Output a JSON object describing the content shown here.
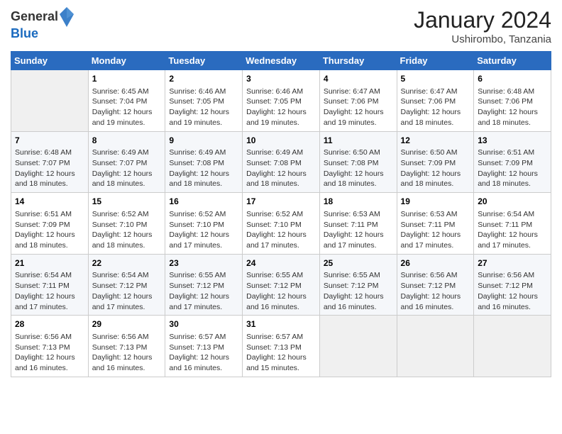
{
  "header": {
    "logo_line1": "General",
    "logo_line2": "Blue",
    "title": "January 2024",
    "subtitle": "Ushirombo, Tanzania"
  },
  "days_of_week": [
    "Sunday",
    "Monday",
    "Tuesday",
    "Wednesday",
    "Thursday",
    "Friday",
    "Saturday"
  ],
  "weeks": [
    [
      {
        "day": "",
        "detail": ""
      },
      {
        "day": "1",
        "detail": "Sunrise: 6:45 AM\nSunset: 7:04 PM\nDaylight: 12 hours\nand 19 minutes."
      },
      {
        "day": "2",
        "detail": "Sunrise: 6:46 AM\nSunset: 7:05 PM\nDaylight: 12 hours\nand 19 minutes."
      },
      {
        "day": "3",
        "detail": "Sunrise: 6:46 AM\nSunset: 7:05 PM\nDaylight: 12 hours\nand 19 minutes."
      },
      {
        "day": "4",
        "detail": "Sunrise: 6:47 AM\nSunset: 7:06 PM\nDaylight: 12 hours\nand 19 minutes."
      },
      {
        "day": "5",
        "detail": "Sunrise: 6:47 AM\nSunset: 7:06 PM\nDaylight: 12 hours\nand 18 minutes."
      },
      {
        "day": "6",
        "detail": "Sunrise: 6:48 AM\nSunset: 7:06 PM\nDaylight: 12 hours\nand 18 minutes."
      }
    ],
    [
      {
        "day": "7",
        "detail": "Sunrise: 6:48 AM\nSunset: 7:07 PM\nDaylight: 12 hours\nand 18 minutes."
      },
      {
        "day": "8",
        "detail": "Sunrise: 6:49 AM\nSunset: 7:07 PM\nDaylight: 12 hours\nand 18 minutes."
      },
      {
        "day": "9",
        "detail": "Sunrise: 6:49 AM\nSunset: 7:08 PM\nDaylight: 12 hours\nand 18 minutes."
      },
      {
        "day": "10",
        "detail": "Sunrise: 6:49 AM\nSunset: 7:08 PM\nDaylight: 12 hours\nand 18 minutes."
      },
      {
        "day": "11",
        "detail": "Sunrise: 6:50 AM\nSunset: 7:08 PM\nDaylight: 12 hours\nand 18 minutes."
      },
      {
        "day": "12",
        "detail": "Sunrise: 6:50 AM\nSunset: 7:09 PM\nDaylight: 12 hours\nand 18 minutes."
      },
      {
        "day": "13",
        "detail": "Sunrise: 6:51 AM\nSunset: 7:09 PM\nDaylight: 12 hours\nand 18 minutes."
      }
    ],
    [
      {
        "day": "14",
        "detail": "Sunrise: 6:51 AM\nSunset: 7:09 PM\nDaylight: 12 hours\nand 18 minutes."
      },
      {
        "day": "15",
        "detail": "Sunrise: 6:52 AM\nSunset: 7:10 PM\nDaylight: 12 hours\nand 18 minutes."
      },
      {
        "day": "16",
        "detail": "Sunrise: 6:52 AM\nSunset: 7:10 PM\nDaylight: 12 hours\nand 17 minutes."
      },
      {
        "day": "17",
        "detail": "Sunrise: 6:52 AM\nSunset: 7:10 PM\nDaylight: 12 hours\nand 17 minutes."
      },
      {
        "day": "18",
        "detail": "Sunrise: 6:53 AM\nSunset: 7:11 PM\nDaylight: 12 hours\nand 17 minutes."
      },
      {
        "day": "19",
        "detail": "Sunrise: 6:53 AM\nSunset: 7:11 PM\nDaylight: 12 hours\nand 17 minutes."
      },
      {
        "day": "20",
        "detail": "Sunrise: 6:54 AM\nSunset: 7:11 PM\nDaylight: 12 hours\nand 17 minutes."
      }
    ],
    [
      {
        "day": "21",
        "detail": "Sunrise: 6:54 AM\nSunset: 7:11 PM\nDaylight: 12 hours\nand 17 minutes."
      },
      {
        "day": "22",
        "detail": "Sunrise: 6:54 AM\nSunset: 7:12 PM\nDaylight: 12 hours\nand 17 minutes."
      },
      {
        "day": "23",
        "detail": "Sunrise: 6:55 AM\nSunset: 7:12 PM\nDaylight: 12 hours\nand 17 minutes."
      },
      {
        "day": "24",
        "detail": "Sunrise: 6:55 AM\nSunset: 7:12 PM\nDaylight: 12 hours\nand 16 minutes."
      },
      {
        "day": "25",
        "detail": "Sunrise: 6:55 AM\nSunset: 7:12 PM\nDaylight: 12 hours\nand 16 minutes."
      },
      {
        "day": "26",
        "detail": "Sunrise: 6:56 AM\nSunset: 7:12 PM\nDaylight: 12 hours\nand 16 minutes."
      },
      {
        "day": "27",
        "detail": "Sunrise: 6:56 AM\nSunset: 7:12 PM\nDaylight: 12 hours\nand 16 minutes."
      }
    ],
    [
      {
        "day": "28",
        "detail": "Sunrise: 6:56 AM\nSunset: 7:13 PM\nDaylight: 12 hours\nand 16 minutes."
      },
      {
        "day": "29",
        "detail": "Sunrise: 6:56 AM\nSunset: 7:13 PM\nDaylight: 12 hours\nand 16 minutes."
      },
      {
        "day": "30",
        "detail": "Sunrise: 6:57 AM\nSunset: 7:13 PM\nDaylight: 12 hours\nand 16 minutes."
      },
      {
        "day": "31",
        "detail": "Sunrise: 6:57 AM\nSunset: 7:13 PM\nDaylight: 12 hours\nand 15 minutes."
      },
      {
        "day": "",
        "detail": ""
      },
      {
        "day": "",
        "detail": ""
      },
      {
        "day": "",
        "detail": ""
      }
    ]
  ]
}
